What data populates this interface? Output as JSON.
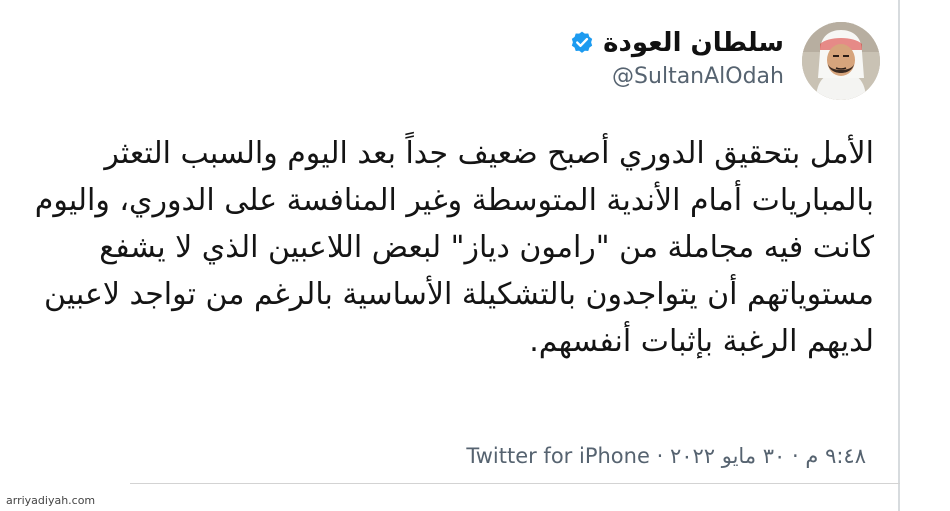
{
  "tweet": {
    "author": {
      "display_name": "سلطان العودة",
      "handle": "@SultanAlOdah",
      "verified": true
    },
    "text": "الأمل بتحقيق الدوري أصبح ضعيف جداً بعد اليوم والسبب التعثر بالمباريات أمام الأندية المتوسطة وغير المنافسة على الدوري، واليوم كانت فيه مجاملة من \"رامون دياز\" لبعض اللاعبين الذي لا يشفع مستوياتهم أن يتواجدون بالتشكيلة الأساسية بالرغم من تواجد لاعبين لديهم الرغبة بإثبات أنفسهم.",
    "meta": {
      "time": "٩:٤٨ م",
      "separator": "·",
      "date": "٣٠ مايو ٢٠٢٢",
      "source": "Twitter for iPhone"
    }
  },
  "watermark": "arriyadiyah.com",
  "colors": {
    "verified": "#1d9bf0",
    "secondary_text": "#566370",
    "primary_text": "#141414"
  },
  "icons": {
    "verified": "verified-badge-icon",
    "avatar": "user-avatar"
  }
}
